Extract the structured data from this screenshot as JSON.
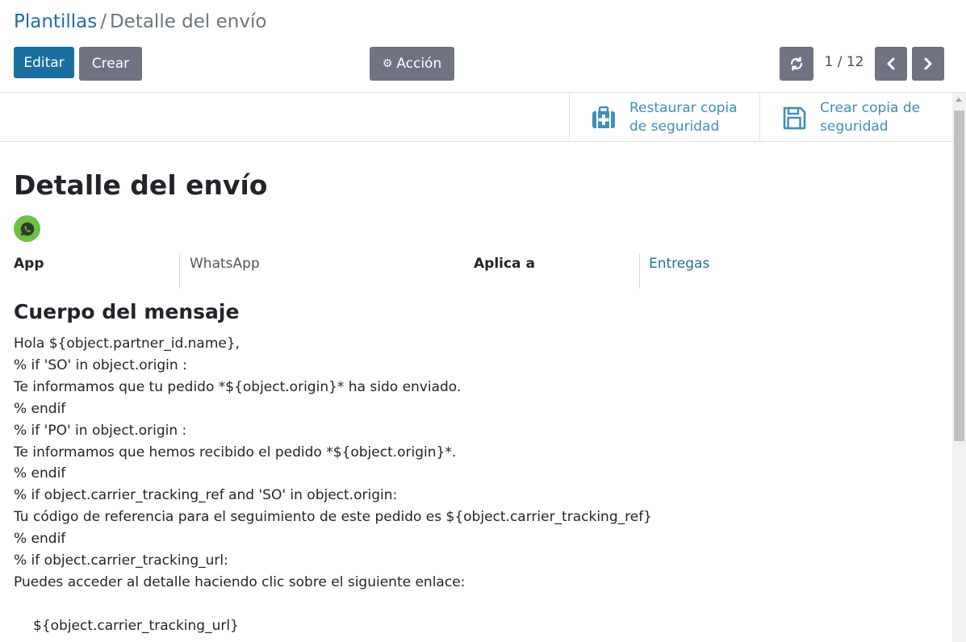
{
  "breadcrumb": {
    "parent": "Plantillas",
    "separator": "/",
    "current": "Detalle del envío"
  },
  "toolbar": {
    "edit_label": "Editar",
    "create_label": "Crear",
    "action_label": "Acción",
    "pager": "1 / 12"
  },
  "smart_buttons": {
    "restore_label": "Restaurar copia de seguridad",
    "backup_label": "Crear copia de seguridad"
  },
  "record": {
    "title": "Detalle del envío",
    "fields": {
      "app_label": "App",
      "app_value": "WhatsApp",
      "applies_label": "Aplica a",
      "applies_value": "Entregas"
    },
    "body_section_title": "Cuerpo del mensaje",
    "body_lines": [
      "Hola ${object.partner_id.name},",
      "% if 'SO' in object.origin :",
      "Te informamos que tu pedido *${object.origin}* ha sido enviado.",
      "% endif",
      "% if 'PO' in object.origin :",
      "Te informamos que hemos recibido el pedido *${object.origin}*.",
      "% endif",
      "% if object.carrier_tracking_ref and 'SO' in object.origin:",
      "Tu código de referencia para el seguimiento de este pedido es ${object.carrier_tracking_ref}",
      "% endif",
      "% if object.carrier_tracking_url:",
      "Puedes acceder al detalle haciendo clic sobre el siguiente enlace:",
      "",
      "${object.carrier_tracking_url}"
    ]
  },
  "colors": {
    "primary": "#1a6ea0",
    "secondary": "#6f7382",
    "link": "#1f6f9a",
    "whatsapp": "#6ebf44"
  }
}
